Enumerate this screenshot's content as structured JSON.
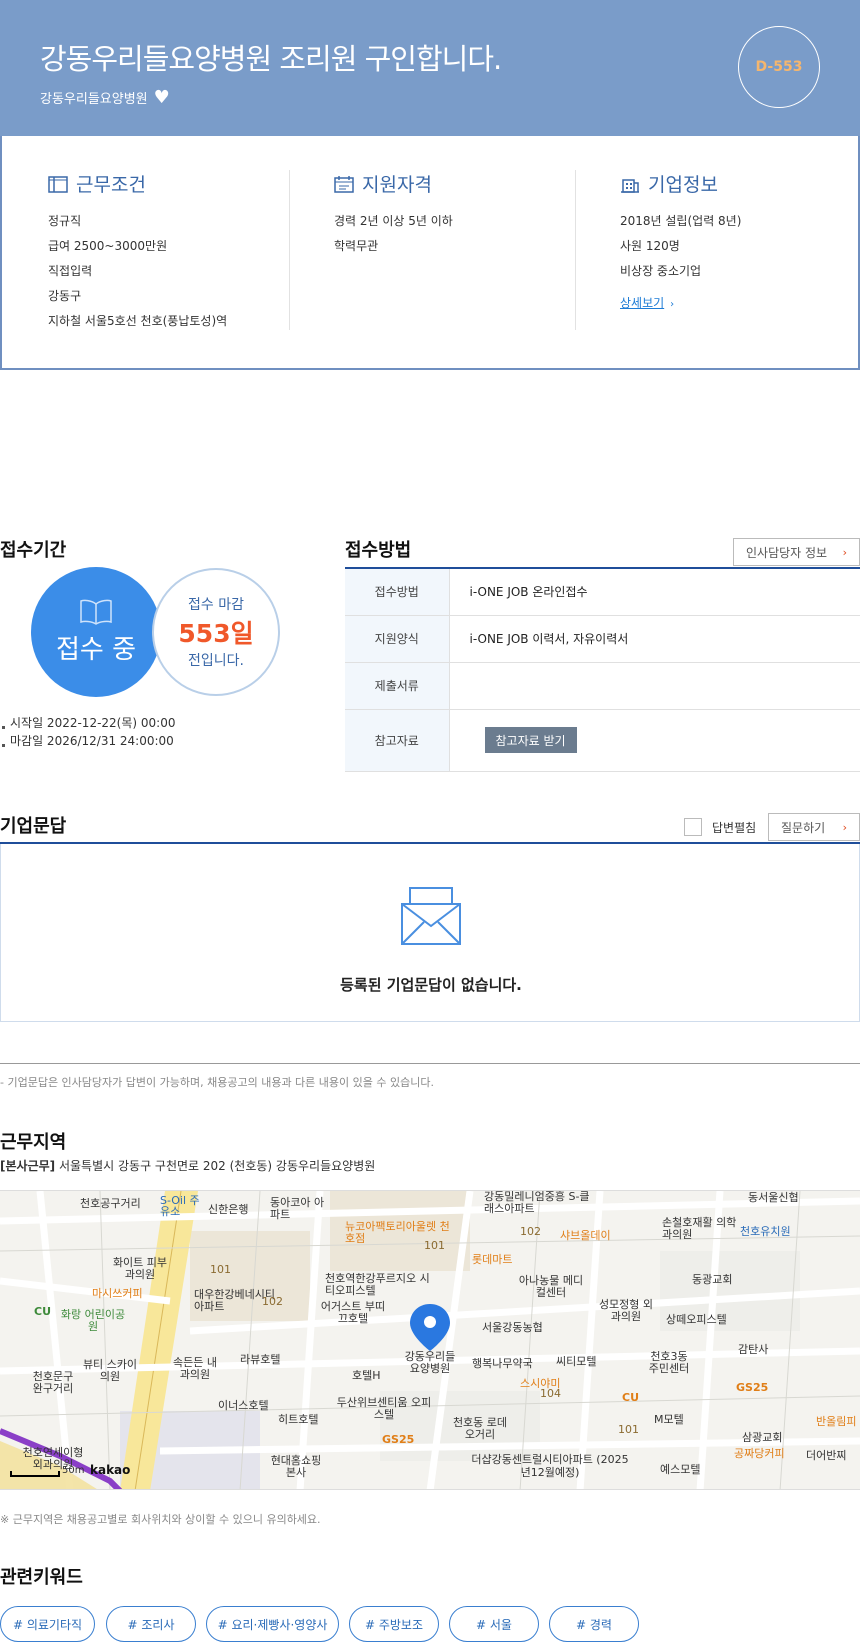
{
  "header": {
    "title": "강동우리들요양병원 조리원 구인합니다.",
    "company": "강동우리들요양병원",
    "dday": "D-553"
  },
  "work_conditions": {
    "title": "근무조건",
    "items": [
      "정규직",
      "급여 2500~3000만원",
      "직접입력",
      "강동구",
      "지하철 서울5호선 천호(풍납토성)역"
    ]
  },
  "qualifications": {
    "title": "지원자격",
    "items": [
      "경력 2년 이상 5년 이하",
      "학력무관"
    ]
  },
  "company_info": {
    "title": "기업정보",
    "items": [
      "2018년 설립(업력 8년)",
      "사원 120명",
      "비상장 중소기업"
    ],
    "more_label": "상세보기"
  },
  "apply_period": {
    "title": "접수기간",
    "status": "접수 중",
    "deadline_label": "접수 마감",
    "days_left": "553일",
    "suffix": "전입니다.",
    "start": "시작일 2022-12-22(목) 00:00",
    "end": "마감일 2026/12/31 24:00:00"
  },
  "apply_method": {
    "title": "접수방법",
    "hr_button": "인사담당자 정보",
    "rows": [
      {
        "label": "접수방법",
        "value": "i-ONE JOB 온라인접수"
      },
      {
        "label": "지원양식",
        "value": "i-ONE JOB 이력서, 자유이력서"
      },
      {
        "label": "제출서류",
        "value": ""
      },
      {
        "label": "참고자료",
        "value": ""
      }
    ],
    "ref_button": "참고자료 받기"
  },
  "qna": {
    "title": "기업문답",
    "unfold_label": "답변펼침",
    "ask_button": "질문하기",
    "empty_text": "등록된 기업문답이 없습니다.",
    "note": "- 기업문답은 인사담당자가 답변이 가능하며, 채용공고의 내용과 다른 내용이 있을 수 있습니다."
  },
  "work_location": {
    "title": "근무지역",
    "tag": "[본사근무]",
    "address": "서울특별시 강동구 구천면로 202 (천호동) 강동우리들요양병원",
    "note": "※ 근무지역은 채용공고별로 회사위치와 상이할 수 있으니 유의하세요.",
    "map_brand": "kakao",
    "map_scale": "50m",
    "map_labels": [
      {
        "text": "천호공구거리",
        "cls": ""
      },
      {
        "text": "S-Oil 주유소",
        "cls": "blue"
      },
      {
        "text": "신한은행",
        "cls": ""
      },
      {
        "text": "동아코아 아파트",
        "cls": ""
      },
      {
        "text": "강동밀레니엄중흥 S-클래스아파트",
        "cls": ""
      },
      {
        "text": "동서울신협",
        "cls": ""
      },
      {
        "text": "뉴코아팩토리아울렛 천호점",
        "cls": "orange"
      },
      {
        "text": "샤브올데이",
        "cls": "orange"
      },
      {
        "text": "손철호재활 의학과의원",
        "cls": ""
      },
      {
        "text": "천호유치원",
        "cls": "blue"
      },
      {
        "text": "화이트 피부과의원",
        "cls": ""
      },
      {
        "text": "롯데마트",
        "cls": "orange"
      },
      {
        "text": "동광교회",
        "cls": ""
      },
      {
        "text": "천호역한강푸르지오 시티오피스텔",
        "cls": ""
      },
      {
        "text": "아나농물 메디컬센터",
        "cls": ""
      },
      {
        "text": "마시쓰커피",
        "cls": "orange"
      },
      {
        "text": "대우한강베네시티 아파트",
        "cls": ""
      },
      {
        "text": "어거스트 부띠끄호텔",
        "cls": ""
      },
      {
        "text": "성모정형 외과의원",
        "cls": ""
      },
      {
        "text": "상떼오피스텔",
        "cls": ""
      },
      {
        "text": "화랑 어린이공원",
        "cls": "green"
      },
      {
        "text": "서울강동농협",
        "cls": ""
      },
      {
        "text": "감탄사",
        "cls": ""
      },
      {
        "text": "뷰티 스카이의원",
        "cls": ""
      },
      {
        "text": "속든든 내과의원",
        "cls": ""
      },
      {
        "text": "라뷰호텔",
        "cls": ""
      },
      {
        "text": "강동우리들 요양병원",
        "cls": ""
      },
      {
        "text": "행복나무약국",
        "cls": ""
      },
      {
        "text": "씨티모텔",
        "cls": ""
      },
      {
        "text": "천호3동 주민센터",
        "cls": ""
      },
      {
        "text": "천호문구 완구거리",
        "cls": ""
      },
      {
        "text": "호텔H",
        "cls": ""
      },
      {
        "text": "스시야미",
        "cls": "orange"
      },
      {
        "text": "이너스호텔",
        "cls": ""
      },
      {
        "text": "두산위브센티움 오피스텔",
        "cls": ""
      },
      {
        "text": "M모텔",
        "cls": ""
      },
      {
        "text": "반올림피",
        "cls": "orange"
      },
      {
        "text": "히트호텔",
        "cls": ""
      },
      {
        "text": "천호동 로데오거리",
        "cls": ""
      },
      {
        "text": "삼광교회",
        "cls": ""
      },
      {
        "text": "천호연세이형 외과의원",
        "cls": ""
      },
      {
        "text": "현대홈쇼핑 본사",
        "cls": ""
      },
      {
        "text": "더샵강동센트럴시티아파트 (2025년12월예정)",
        "cls": ""
      },
      {
        "text": "공짜당커피",
        "cls": "orange"
      },
      {
        "text": "예스모텔",
        "cls": ""
      },
      {
        "text": "더어반찌",
        "cls": ""
      }
    ],
    "map_badges": [
      "CU",
      "CU",
      "GS25",
      "GS25",
      "101",
      "102",
      "101",
      "102",
      "104",
      "101"
    ]
  },
  "keywords": {
    "title": "관련키워드",
    "items": [
      "# 의료기타직",
      "# 조리사",
      "# 요리·제빵사·영양사",
      "# 주방보조",
      "# 서울",
      "# 경력"
    ]
  },
  "colors": {
    "header_bg": "#7a9cc9",
    "accent_blue": "#3b8de8",
    "navy": "#1f4e9a",
    "deadline_orange": "#f0582a"
  }
}
